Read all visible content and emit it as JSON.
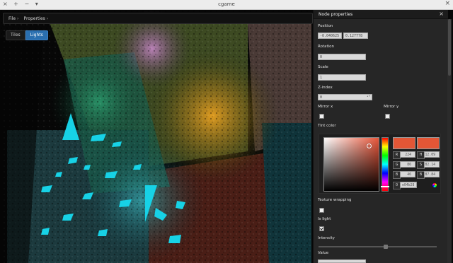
{
  "window": {
    "controls_left": "× + − ▾",
    "title": "cgame",
    "close_glyph": "×"
  },
  "menu": {
    "file_label": "File",
    "properties_label": "Properties",
    "arrow_glyph": "›"
  },
  "mode_toggle": {
    "tiles_label": "Tiles",
    "lights_label": "Lights",
    "active": "Lights"
  },
  "panel": {
    "title": "Node properties",
    "close_glyph": "×",
    "position_label": "Position",
    "position_x": "-0.040625",
    "position_y": "0.127778",
    "rotation_label": "Rotation",
    "rotation_value": "0",
    "scale_label": "Scale",
    "scale_value": "1",
    "zindex_label": "Z-index",
    "zindex_value": "0",
    "mirror_x_label": "Mirror x",
    "mirror_y_label": "Mirror y",
    "mirror_x_checked": false,
    "mirror_y_checked": false,
    "tint_label": "Tint color",
    "texture_wrapping_label": "Texture wrapping",
    "texture_wrapping_checked": false,
    "is_light_label": "Is light",
    "is_light_checked": true,
    "intensity_label": "Intensity",
    "intensity_fraction": 0.57,
    "value_label": "Value"
  },
  "color_picker": {
    "r_label": "R",
    "r_value": "224",
    "g_label": "G",
    "g_value": "86",
    "b_label": "B",
    "b_value": "46",
    "h_label": "H",
    "h_value": "12.09",
    "s_label": "S",
    "s_value": "82.14",
    "bv_label": "B",
    "bv_value": "87.84",
    "a_label": "0",
    "hex_value": "e04b28",
    "base_color": "#e35636",
    "spin_glyph": "▴▾"
  },
  "colors": {
    "accent": "#2a6fb0",
    "panel_bg": "#262626",
    "cyan_light": "#17d2e6",
    "orange_light": "#e8a020",
    "purple_light": "#c080c0"
  }
}
